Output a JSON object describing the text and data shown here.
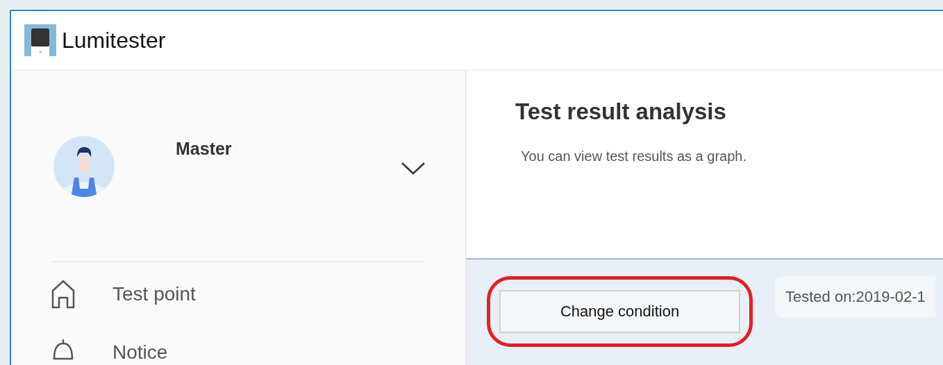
{
  "window": {
    "title": "Lumitester"
  },
  "sidebar": {
    "user": {
      "name": "Master",
      "expanded": false
    },
    "items": [
      {
        "label": "Test point",
        "kind": "home"
      },
      {
        "label": "Notice",
        "kind": "bell"
      }
    ]
  },
  "main": {
    "title": "Test result analysis",
    "subtitle": "You can view test results as a graph.",
    "change_button": {
      "label": "Change condition",
      "highlighted": true
    },
    "tested_on": "Tested on:2019-02-1"
  }
}
